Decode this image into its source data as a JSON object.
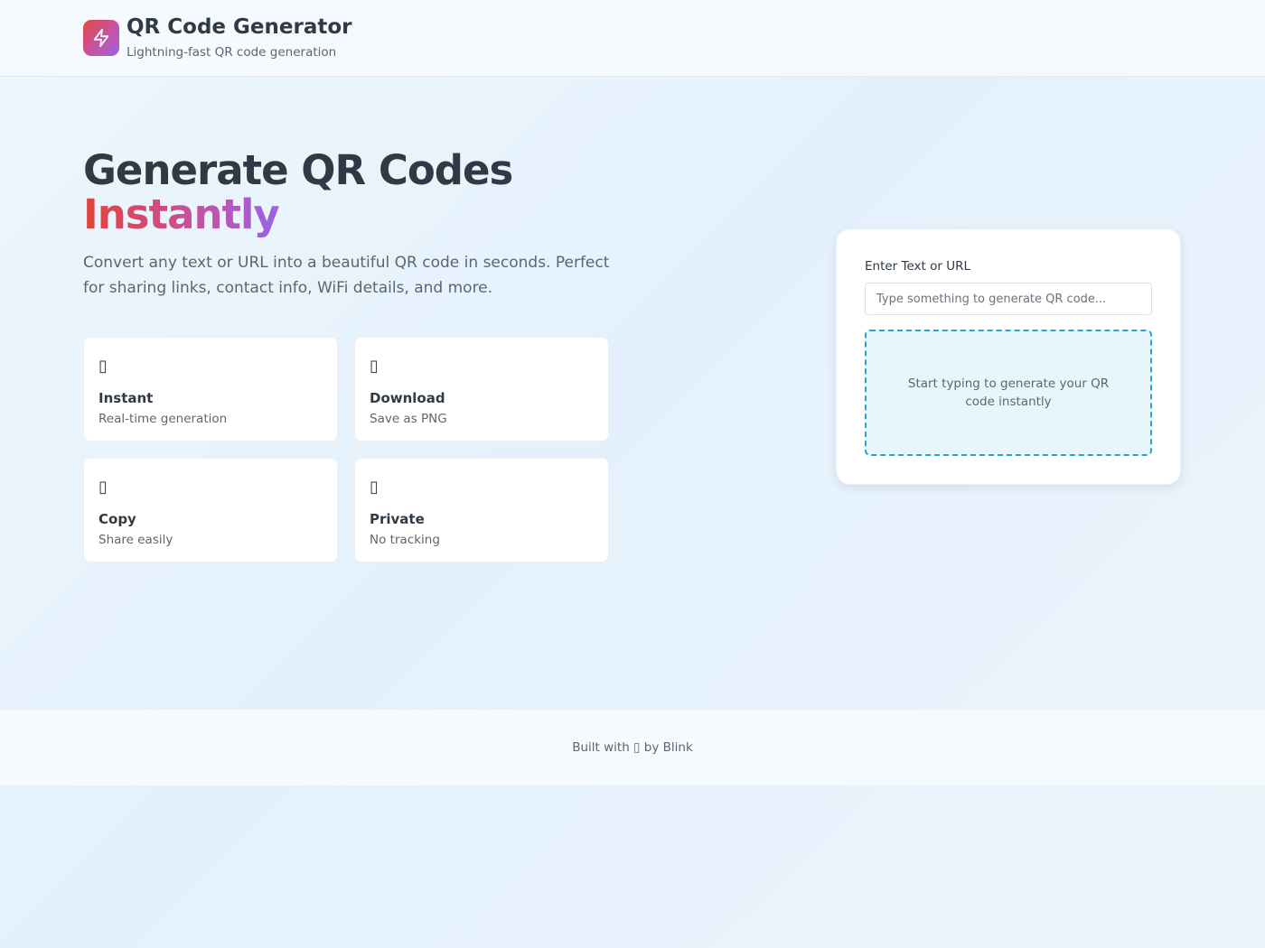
{
  "header": {
    "logo_icon": "lightning-bolt-icon",
    "title": "QR Code Generator",
    "subtitle": "Lightning-fast QR code generation"
  },
  "hero": {
    "title": "Generate QR Codes",
    "accent": "Instantly",
    "description": "Convert any text or URL into a beautiful QR code in seconds. Perfect for sharing links, contact info, WiFi details, and more."
  },
  "features": [
    {
      "icon": "lightning-icon",
      "glyph": "▯",
      "title": "Instant",
      "subtitle": "Real-time generation"
    },
    {
      "icon": "download-icon",
      "glyph": "▯",
      "title": "Download",
      "subtitle": "Save as PNG"
    },
    {
      "icon": "copy-icon",
      "glyph": "▯",
      "title": "Copy",
      "subtitle": "Share easily"
    },
    {
      "icon": "lock-icon",
      "glyph": "▯",
      "title": "Private",
      "subtitle": "No tracking"
    }
  ],
  "generator": {
    "label": "Enter Text or URL",
    "input_value": "",
    "input_placeholder": "Type something to generate QR code...",
    "preview_message": "Start typing to generate your QR code instantly"
  },
  "footer": {
    "text": "Built with ▯ by Blink"
  },
  "colors": {
    "accent_gradient_start": "#e2433a",
    "accent_gradient_end": "#9a63e8",
    "preview_border": "#25a8c4"
  }
}
